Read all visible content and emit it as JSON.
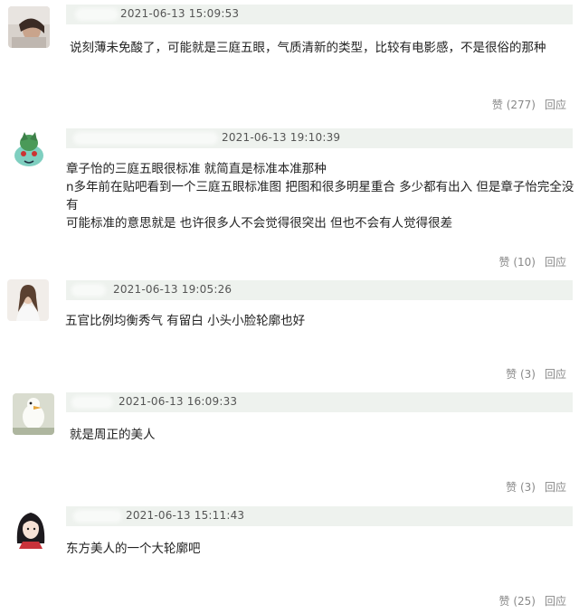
{
  "comments": [
    {
      "timestamp": "2021-06-13 15:09:53",
      "text_lines": [
        "说刻薄未免酸了，可能就是三庭五眼，气质清新的类型，比较有电影感，不是很俗的那种"
      ],
      "likes_label": "赞 (277)",
      "reply_label": "回应"
    },
    {
      "timestamp": "2021-06-13 19:10:39",
      "text_lines": [
        "章子怡的三庭五眼很标准 就简直是标准本准那种",
        "n多年前在贴吧看到一个三庭五眼标准图 把图和很多明星重合 多少都有出入 但是章子怡完全没有",
        "可能标准的意思就是 也许很多人不会觉得很突出 但也不会有人觉得很差"
      ],
      "likes_label": "赞 (10)",
      "reply_label": "回应"
    },
    {
      "timestamp": "2021-06-13 19:05:26",
      "text_lines": [
        "五官比例均衡秀气 有留白 小头小脸轮廓也好"
      ],
      "likes_label": "赞 (3)",
      "reply_label": "回应"
    },
    {
      "timestamp": "2021-06-13 16:09:33",
      "text_lines": [
        "就是周正的美人"
      ],
      "likes_label": "赞 (3)",
      "reply_label": "回应"
    },
    {
      "timestamp": "2021-06-13 15:11:43",
      "text_lines": [
        "东方美人的一个大轮廓吧"
      ],
      "likes_label": "赞 (25)",
      "reply_label": "回应"
    }
  ],
  "colors": {
    "header_bar": "#eef2ee",
    "meta_text": "#888888",
    "body_text": "#222222"
  }
}
